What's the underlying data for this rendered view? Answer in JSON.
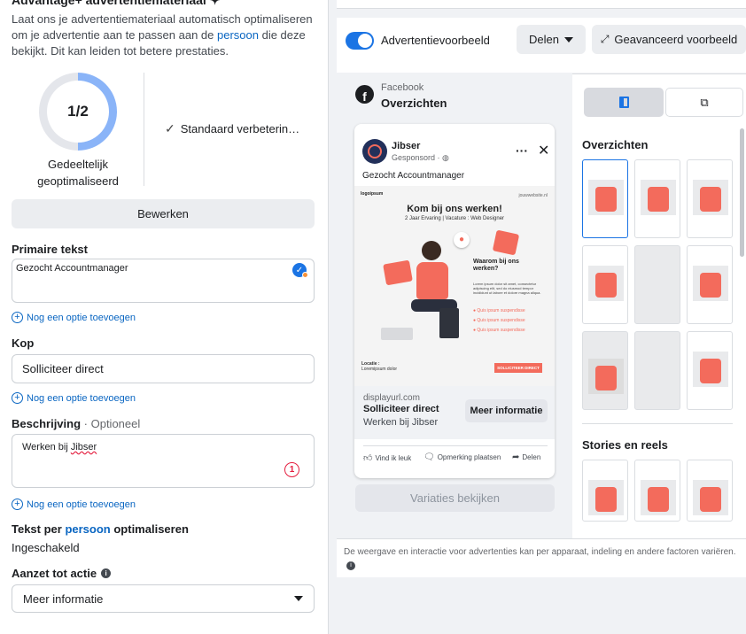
{
  "left": {
    "section_title": "Advantage+ advertentiemateriaal ✦",
    "desc_part1": "Laat ons je advertentiemateriaal automatisch optimaliseren om je advertentie aan te passen aan de ",
    "desc_link": "persoon",
    "desc_part2": " die deze bekijkt. Dit kan leiden tot betere prestaties.",
    "progress_value": "1/2",
    "progress_fraction": 0.5,
    "progress_label": "Gedeeltelijk geoptimaliseerd",
    "standard_label": "Standaard verbeterin…",
    "edit_button": "Bewerken",
    "primary_text_label": "Primaire tekst",
    "primary_text_value": "Gezocht Accountmanager",
    "add_option": "Nog een optie toevoegen",
    "headline_label": "Kop",
    "headline_value": "Solliciteer direct",
    "description_label": "Beschrijving",
    "description_optional": "· Optioneel",
    "description_value_part1": "Werken bij ",
    "description_value_part2": "Jibser",
    "description_count": "1",
    "text_per_person_label_part1": "Tekst per ",
    "text_per_person_link": "persoon",
    "text_per_person_label_part2": " optimaliseren",
    "text_per_person_value": "Ingeschakeld",
    "cta_label": "Aanzet tot actie",
    "cta_value": "Meer informatie"
  },
  "preview": {
    "toggle_label": "Advertentievoorbeeld",
    "share_button": "Delen",
    "advanced_button": "Geavanceerd voorbeeld",
    "platform": "Facebook",
    "placement": "Overzichten",
    "brand": "Jibser",
    "sponsored": "Gesponsord · ",
    "post_text": "Gezocht Accountmanager",
    "creative_logo": "logoipsum",
    "creative_site": "jouwwebsite.nl",
    "creative_headline": "Kom bij ons werken!",
    "creative_sub": "2 Jaar Ervaring | Vacature : Web Designer",
    "creative_q": "Waarom bij ons werken?",
    "creative_body": "Lorem ipsum dolor sit amet, consectetur adipiscing elit, sed do eiusmod tempor incididunt ut labore et dolore magna aliqua.",
    "creative_bullets": [
      "Quis ipsum suspendisse",
      "Quis ipsum suspendisse",
      "Quis ipsum suspendisse"
    ],
    "creative_location_label": "Locatie :",
    "creative_location_value": "Loremipsum dolor",
    "creative_cta": "SOLLICITEER DIRECT",
    "display_url": "displayurl.com",
    "headline": "Solliciteer direct",
    "description": "Werken bij Jibser",
    "cta_button": "Meer informatie",
    "like": "Vind ik leuk",
    "comment": "Opmerking plaatsen",
    "share": "Delen",
    "variations_button": "Variaties bekijken",
    "thumbs_feeds_title": "Overzichten",
    "thumbs_stories_title": "Stories en reels",
    "footer_text": "De weergave en interactie voor advertenties kan per apparaat, indeling en andere factoren variëren."
  },
  "colors": {
    "accent": "#1b74e4",
    "link": "#0a66c2",
    "coral": "#f36b5c",
    "error": "#e41e3f"
  }
}
